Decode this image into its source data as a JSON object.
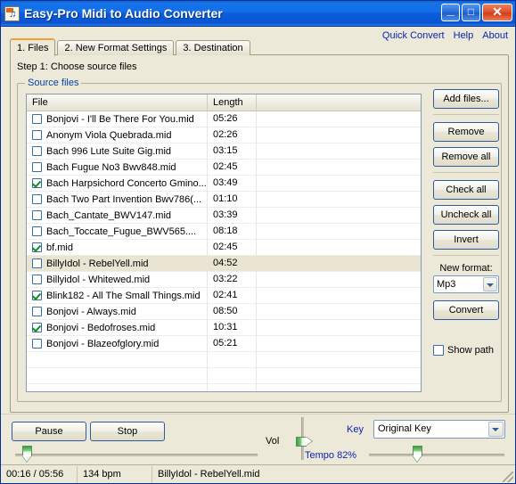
{
  "window": {
    "title": "Easy-Pro Midi to Audio Converter",
    "icon": "midi-file-icon",
    "minimize_label": "_",
    "maximize_label": "□",
    "close_label": "✕"
  },
  "links": [
    {
      "label": "Quick Convert",
      "name": "quick-convert-link"
    },
    {
      "label": "Help",
      "name": "help-link"
    },
    {
      "label": "About",
      "name": "about-link"
    }
  ],
  "tabs": [
    {
      "label": "1. Files",
      "active": true
    },
    {
      "label": "2. New Format Settings",
      "active": false
    },
    {
      "label": "3. Destination",
      "active": false
    }
  ],
  "step_label": "Step 1: Choose source files",
  "group": {
    "legend": "Source files"
  },
  "list": {
    "columns": [
      "File",
      "Length",
      ""
    ],
    "rows": [
      {
        "checked": false,
        "selected": false,
        "file": "Bonjovi - I'll Be There For You.mid",
        "length": "05:26"
      },
      {
        "checked": false,
        "selected": false,
        "file": "Anonym Viola Quebrada.mid",
        "length": "02:26"
      },
      {
        "checked": false,
        "selected": false,
        "file": "Bach 996 Lute Suite Gig.mid",
        "length": "03:15"
      },
      {
        "checked": false,
        "selected": false,
        "file": "Bach Fugue No3 Bwv848.mid",
        "length": "02:45"
      },
      {
        "checked": true,
        "selected": false,
        "file": "Bach Harpsichord Concerto Gmino...",
        "length": "03:49"
      },
      {
        "checked": false,
        "selected": false,
        "file": "Bach Two Part Invention Bwv786(...",
        "length": "01:10"
      },
      {
        "checked": false,
        "selected": false,
        "file": "Bach_Cantate_BWV147.mid",
        "length": "03:39"
      },
      {
        "checked": false,
        "selected": false,
        "file": "Bach_Toccate_Fugue_BWV565....",
        "length": "08:18"
      },
      {
        "checked": true,
        "selected": false,
        "file": "bf.mid",
        "length": "02:45"
      },
      {
        "checked": false,
        "selected": true,
        "file": "BillyIdol - RebelYell.mid",
        "length": "04:52"
      },
      {
        "checked": false,
        "selected": false,
        "file": "Billyidol - Whitewed.mid",
        "length": "03:22"
      },
      {
        "checked": true,
        "selected": false,
        "file": "Blink182 - All The Small Things.mid",
        "length": "02:41"
      },
      {
        "checked": false,
        "selected": false,
        "file": "Bonjovi - Always.mid",
        "length": "08:50"
      },
      {
        "checked": true,
        "selected": false,
        "file": "Bonjovi - Bedofroses.mid",
        "length": "10:31"
      },
      {
        "checked": false,
        "selected": false,
        "file": "Bonjovi - Blazeofglory.mid",
        "length": "05:21"
      }
    ],
    "empty_rows": 5
  },
  "side_buttons": {
    "add_files": "Add files...",
    "remove": "Remove",
    "remove_all": "Remove all",
    "check_all": "Check all",
    "uncheck_all": "Uncheck all",
    "invert": "Invert",
    "new_format_label": "New format:",
    "new_format_value": "Mp3",
    "convert": "Convert",
    "show_path_label": "Show path",
    "show_path_checked": false
  },
  "transport": {
    "pause": "Pause",
    "stop": "Stop",
    "seek_percent": 5
  },
  "controls": {
    "vol_label": "Vol",
    "vol_percent": 58,
    "tempo_label": "Tempo 82%",
    "tempo_percent": 36,
    "key_label": "Key",
    "key_value": "Original Key"
  },
  "status": {
    "time": "00:16 / 05:56",
    "bpm": "134 bpm",
    "track": "BillyIdol - RebelYell.mid"
  },
  "colors": {
    "title_blue": "#0b5ddc",
    "face": "#ece9d8",
    "link_blue": "#0a1fb0",
    "check_green": "#128a22",
    "active_tab_accent": "#f0a22e",
    "selection": "#e9e5d2"
  }
}
